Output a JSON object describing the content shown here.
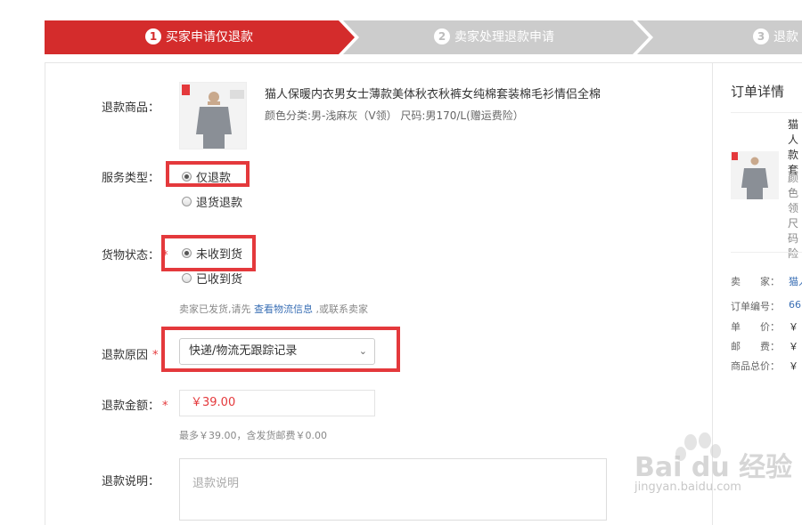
{
  "steps": [
    {
      "num": "1",
      "label": "买家申请仅退款",
      "active": true
    },
    {
      "num": "2",
      "label": "卖家处理退款申请",
      "active": false
    },
    {
      "num": "3",
      "label": "退款",
      "active": false
    }
  ],
  "product": {
    "label": "退款商品：",
    "title": "猫人保暖内衣男女士薄款美体秋衣秋裤女纯棉套装棉毛衫情侣全棉",
    "sku": "颜色分类:男-浅麻灰（V领）  尺码:男170/L(赠运费险）",
    "brand_tag": "猫人"
  },
  "service_type": {
    "label": "服务类型：",
    "options": [
      "仅退款",
      "退货退款"
    ],
    "selected": "仅退款"
  },
  "goods_status": {
    "label": "货物状态：",
    "required_mark": "*",
    "options": [
      "未收到货",
      "已收到货"
    ],
    "selected": "未收到货",
    "hint_prefix": "卖家已发货,请先",
    "hint_link": "查看物流信息",
    "hint_suffix": ",或联系卖家"
  },
  "refund_reason": {
    "label": "退款原因",
    "required_mark": "*",
    "value": "快递/物流无跟踪记录",
    "chevron_icon": "chevron-down-icon"
  },
  "refund_amount": {
    "label": "退款金额：",
    "required_mark": "*",
    "value": "￥39.00",
    "hint": "最多￥39.00，含发货邮费￥0.00"
  },
  "refund_note": {
    "label": "退款说明：",
    "placeholder": "退款说明"
  },
  "order_details": {
    "title": "订单详情",
    "name_fragment": "猫人款套",
    "sku_fragment": "颜色领尺码险",
    "rows": [
      {
        "label": "卖　　家：",
        "value": "猫人",
        "link": true
      },
      {
        "label": "订单编号：",
        "value": "66",
        "link": true
      },
      {
        "label": "单　　价：",
        "value": "￥",
        "link": false
      },
      {
        "label": "邮　　费：",
        "value": "￥",
        "link": false
      },
      {
        "label": "商品总价：",
        "value": "￥",
        "link": false
      }
    ]
  },
  "watermark": {
    "brand": "Bai du 经验",
    "url": "jingyan.baidu.com"
  },
  "colors": {
    "accent_red": "#d42c2c",
    "step_inactive": "#cccccc",
    "highlight": "#e4393c",
    "link_blue": "#3a6fb5"
  }
}
